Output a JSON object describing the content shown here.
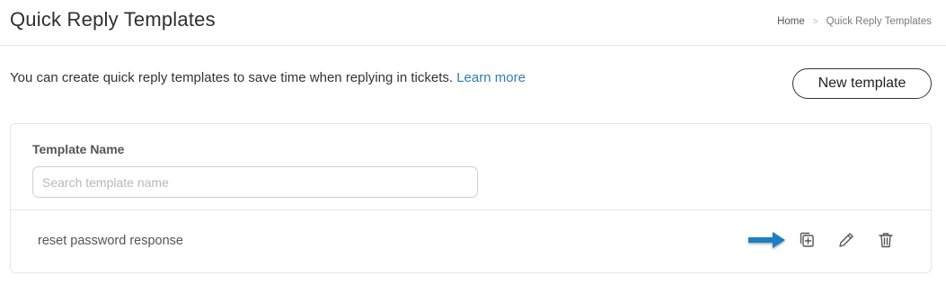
{
  "header": {
    "title": "Quick Reply Templates",
    "breadcrumb": {
      "home": "Home",
      "separator": ">",
      "current": "Quick Reply Templates"
    }
  },
  "intro": {
    "text": "You can create quick reply templates to save time when replying in tickets.",
    "link_label": "Learn more"
  },
  "actions": {
    "new_template_label": "New template"
  },
  "table": {
    "column_header": "Template Name",
    "search_placeholder": "Search template name",
    "search_value": "",
    "rows": [
      {
        "name": "reset password response",
        "actions": [
          "duplicate-icon",
          "edit-icon",
          "delete-icon"
        ]
      }
    ]
  },
  "colors": {
    "link": "#2e7fb0",
    "arrow": "#1f7fc4",
    "border": "#e6e6e6"
  }
}
